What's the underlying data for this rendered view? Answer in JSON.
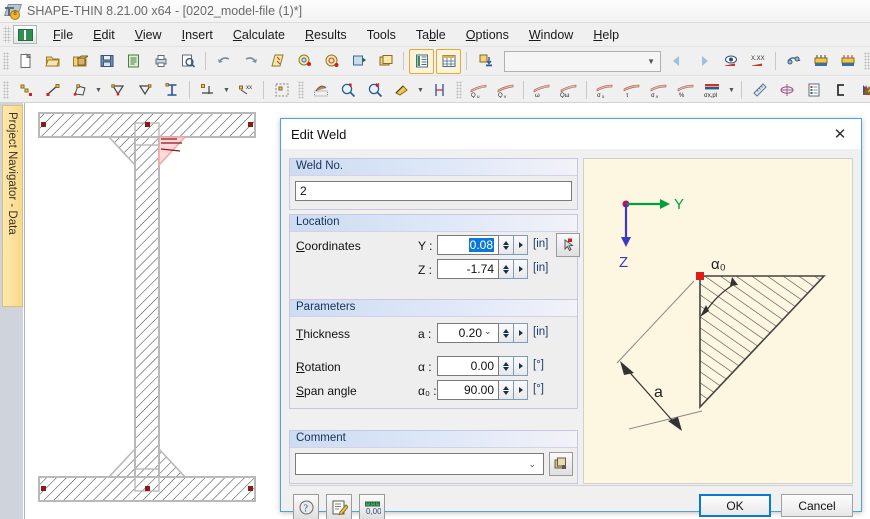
{
  "window": {
    "title": "SHAPE-THIN 8.21.00 x64 - [0202_model-file (1)*]",
    "icon": "shape-thin-app-icon"
  },
  "menubar": {
    "items": [
      {
        "label": "File",
        "accel": "F"
      },
      {
        "label": "Edit",
        "accel": "E"
      },
      {
        "label": "View",
        "accel": "V"
      },
      {
        "label": "Insert",
        "accel": "I"
      },
      {
        "label": "Calculate",
        "accel": "C"
      },
      {
        "label": "Results",
        "accel": "R"
      },
      {
        "label": "Tools",
        "accel": "T"
      },
      {
        "label": "Table",
        "accel": "b"
      },
      {
        "label": "Options",
        "accel": "O"
      },
      {
        "label": "Window",
        "accel": "W"
      },
      {
        "label": "Help",
        "accel": "H"
      }
    ]
  },
  "toolbar_main": {
    "icons": [
      "new-file-icon",
      "open-file-icon",
      "open-example-icon",
      "save-icon",
      "save-all-icon",
      "print-icon",
      "print-preview-icon",
      "undo-icon",
      "redo-icon",
      "section-properties-icon",
      "select-visibility-icon",
      "render-icon",
      "import-dxf-icon",
      "new-window-icon",
      "show-tables-icon",
      "show-grid-table-icon",
      "download-icon"
    ],
    "combo_value": "",
    "nav_icons": [
      "back-icon",
      "forward-icon",
      "show-results-icon",
      "result-values-icon",
      "loading-icon",
      "load-cases-icon",
      "load-combinations-icon",
      "calculate-icon",
      "settings-icon",
      "node-snap-icon",
      "rotate-icon",
      "mirror-icon",
      "move-icon"
    ]
  },
  "toolbar_second": {
    "icons": [
      "new-node-icon",
      "new-line-icon",
      "new-polygon-icon",
      "new-element-icon",
      "new-element-tapered-icon",
      "new-profile-icon",
      "new-support-icon",
      "new-load-icon",
      "new-stiffener-icon",
      "weld-icon",
      "zoom-in-icon",
      "zoom-out-icon",
      "fill-icon",
      "dimension-icon"
    ],
    "result_icons": [
      "Qu",
      "Qv",
      "ω",
      "Qω",
      "σx",
      "τ",
      "σv",
      "%",
      "σx,pl"
    ],
    "tail_icons": [
      "ruler-icon",
      "center-of-gravity-icon",
      "report-icon",
      "section-shape-icon",
      "color-palette-icon"
    ],
    "field_value": ""
  },
  "navigator": {
    "tab_label": "Project Navigator - Data"
  },
  "dialog": {
    "title": "Edit Weld",
    "close_icon": "close-icon",
    "weld_no": {
      "header": "Weld No.",
      "value": "2"
    },
    "location": {
      "header": "Location",
      "coordinates_label": "Coordinates",
      "coordinates_accel": "C",
      "y_label": "Y :",
      "y_value": "0.08",
      "y_unit": "[in]",
      "z_label": "Z :",
      "z_value": "-1.74",
      "z_unit": "[in]",
      "pick_icon": "pick-point-icon"
    },
    "parameters": {
      "header": "Parameters",
      "thickness_label": "Thickness",
      "thickness_accel": "T",
      "thickness_symbol": "a :",
      "thickness_value": "0.20",
      "thickness_unit": "[in]",
      "rotation_label": "Rotation",
      "rotation_accel": "R",
      "rotation_symbol": "α :",
      "rotation_value": "0.00",
      "rotation_unit": "[°]",
      "span_label": "Span angle",
      "span_accel": "S",
      "span_symbol": "α₀ :",
      "span_value": "90.00",
      "span_unit": "[°]"
    },
    "comment": {
      "header": "Comment",
      "value": "",
      "copy_icon": "comment-library-icon"
    },
    "preview": {
      "axis_y_label": "Y",
      "axis_z_label": "Z",
      "angle_label": "α₀",
      "thickness_label": "a",
      "background_color": "#fdf6e0",
      "axis_y_color": "#00a040",
      "axis_z_color": "#3b3bbe",
      "origin_color": "#cc0066",
      "weld_point_color": "#e01b1b"
    },
    "footer": {
      "help_icon": "help-icon",
      "edit_icon": "edit-note-icon",
      "units_icon": "units-icon",
      "ok_label": "OK",
      "cancel_label": "Cancel"
    }
  },
  "section_view": {
    "shape": "i-beam-cross-section",
    "node_color": "#8b1a1a",
    "selected_weld_color": "#e04b4b",
    "hatch_color": "#3a3a3a"
  }
}
